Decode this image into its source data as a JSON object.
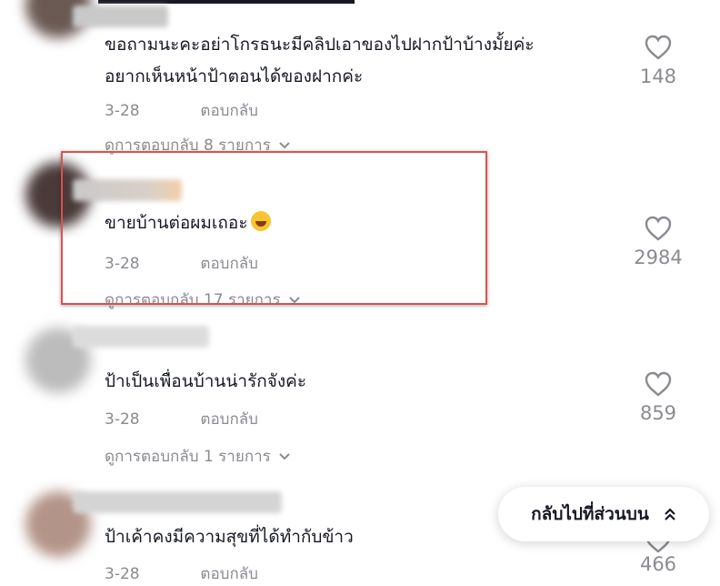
{
  "comments": [
    {
      "text_line1": "ขอถามนะคะอย่าโกรธนะมีคลิปเอาของไปฝากป้าบ้างมั้ยค่ะ",
      "text_line2": "อยากเห็นหน้าป้าตอนได้ของฝากค่ะ",
      "date": "3-28",
      "reply": "ตอบกลับ",
      "view_replies": "ดูการตอบกลับ 8 รายการ",
      "likes": "148"
    },
    {
      "text_line1": "ขายบ้านต่อผมเถอะ",
      "date": "3-28",
      "reply": "ตอบกลับ",
      "view_replies": "ดูการตอบกลับ 17 รายการ",
      "likes": "2984"
    },
    {
      "text_line1": "ป้าเป็นเพื่อนบ้านน่ารักจังค่ะ",
      "date": "3-28",
      "reply": "ตอบกลับ",
      "view_replies": "ดูการตอบกลับ 1 รายการ",
      "likes": "859"
    },
    {
      "text_line1": "ป้าเค้าคงมีความสุขที่ได้ทำกับข้าว",
      "date": "3-28",
      "reply": "ตอบกลับ",
      "likes": "466"
    }
  ],
  "back_to_top": "กลับไปที่ส่วนบน",
  "colors": {
    "highlight": "#d9534f",
    "meta": "#8a8b91",
    "text": "#161823"
  },
  "icons": {
    "like": "heart-outline-icon",
    "expand": "chevron-down-icon",
    "back": "double-chevron-up-icon",
    "emoji": "laughing-emoji"
  }
}
